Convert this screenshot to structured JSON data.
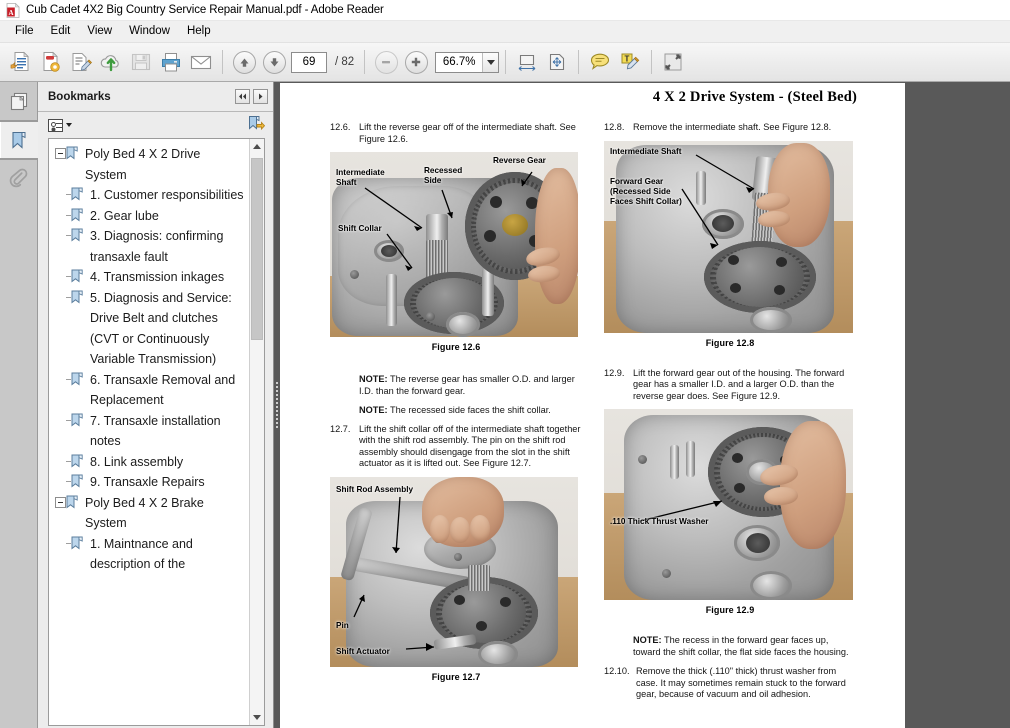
{
  "window": {
    "title": "Cub Cadet 4X2 Big Country Service Repair Manual.pdf - Adobe Reader",
    "app_icon": "pdf-icon"
  },
  "menubar": {
    "items": [
      {
        "label": "File"
      },
      {
        "label": "Edit"
      },
      {
        "label": "View"
      },
      {
        "label": "Window"
      },
      {
        "label": "Help"
      }
    ]
  },
  "toolbar": {
    "buttons": [
      {
        "name": "open-file-icon"
      },
      {
        "name": "create-pdf-icon"
      },
      {
        "name": "edit-pdf-icon"
      },
      {
        "name": "upload-cloud-icon"
      },
      {
        "name": "save-icon"
      },
      {
        "name": "print-icon"
      },
      {
        "name": "email-icon"
      }
    ],
    "page_prev": "▲",
    "page_next": "▼",
    "page_current": "69",
    "page_total": "/ 82",
    "zoom_out": "−",
    "zoom_in": "+",
    "zoom_value": "66.7%",
    "fit_width_icon": "fit-width-icon",
    "fit_page_icon": "fit-page-icon",
    "comment_icon": "comment-balloon-icon",
    "highlight_icon": "text-comment-icon",
    "fullscreen_icon": "fullscreen-icon"
  },
  "rail": {
    "items": [
      {
        "name": "page-thumbnails-icon",
        "selected": false
      },
      {
        "name": "bookmarks-icon",
        "selected": true
      },
      {
        "name": "attachments-paperclip-icon",
        "selected": false
      }
    ]
  },
  "bookmarks_panel": {
    "title": "Bookmarks",
    "prev_button": "◀◀",
    "next_button": "▶",
    "options_label": "bookmark-options",
    "new_bookmark_icon": "new-bookmark-icon",
    "items": [
      {
        "label": "Poly Bed 4 X 2 Drive System",
        "level": 0,
        "expanded": true
      },
      {
        "label": "1. Customer responsibilities",
        "level": 1
      },
      {
        "label": "2. Gear lube",
        "level": 1
      },
      {
        "label": "3. Diagnosis: confirming transaxle fault",
        "level": 1
      },
      {
        "label": "4. Transmission inkages",
        "level": 1
      },
      {
        "label": "5. Diagnosis and Service: Drive Belt and clutches (CVT or Continuously Variable Transmission)",
        "level": 1
      },
      {
        "label": "6. Transaxle Removal and Replacement",
        "level": 1
      },
      {
        "label": "7. Transaxle installation notes",
        "level": 1
      },
      {
        "label": "8. Link assembly",
        "level": 1
      },
      {
        "label": "9. Transaxle Repairs",
        "level": 1
      },
      {
        "label": "Poly Bed 4 X 2 Brake System",
        "level": 0,
        "expanded": true
      },
      {
        "label": "1. Maintnance and description of the",
        "level": 1
      }
    ]
  },
  "document": {
    "header": "4 X 2 Drive System - (Steel Bed)",
    "left_column": {
      "step_126_num": "12.6.",
      "step_126_text": "Lift the reverse gear off of the intermediate shaft. See Figure 12.6.",
      "figure_126_caption": "Figure 12.6",
      "figure_126_labels": [
        "Intermediate\nShaft",
        "Recessed\nSide",
        "Reverse Gear",
        "Shift Collar"
      ],
      "note_1": "NOTE:",
      "note_1_text": " The reverse gear has smaller O.D. and larger I.D. than the forward gear.",
      "note_2": "NOTE:",
      "note_2_text": " The recessed side faces the shift collar.",
      "step_127_num": "12.7.",
      "step_127_text": "Lift the shift collar off of the intermediate shaft together with the shift rod assembly. The pin on the shift rod assembly should disengage from the slot in the shift actuator as it is lifted out. See Figure 12.7.",
      "figure_127_caption": "Figure 12.7",
      "figure_127_labels": [
        "Shift Rod Assembly",
        "Pin",
        "Shift Actuator"
      ]
    },
    "right_column": {
      "step_128_num": "12.8.",
      "step_128_text": "Remove the intermediate shaft. See Figure 12.8.",
      "figure_128_caption": "Figure 12.8",
      "figure_128_labels": [
        "Intermediate Shaft",
        "Forward Gear\n(Recessed Side\nFaces Shift Collar)"
      ],
      "step_129_num": "12.9.",
      "step_129_text": "Lift the forward gear out of the housing. The forward gear has a smaller I.D. and a larger O.D. than the reverse gear does.  See Figure 12.9.",
      "figure_129_caption": "Figure 12.9",
      "figure_129_labels": [
        ".110 Thick Thrust Washer"
      ],
      "note_3": "NOTE:",
      "note_3_text": " The recess in the forward gear faces up, toward the shift collar, the flat side faces the housing.",
      "step_1210_num": "12.10.",
      "step_1210_text": "Remove the thick (.110\" thick) thrust washer from case. It may sometimes remain stuck to the forward gear, because of vacuum and oil adhesion."
    }
  },
  "colors": {
    "workspace": "#595959",
    "chrome": "#f0f0f0",
    "panel": "#ececec",
    "accent_blue": "#8ab4d8",
    "pdf_red": "#c8202a"
  }
}
